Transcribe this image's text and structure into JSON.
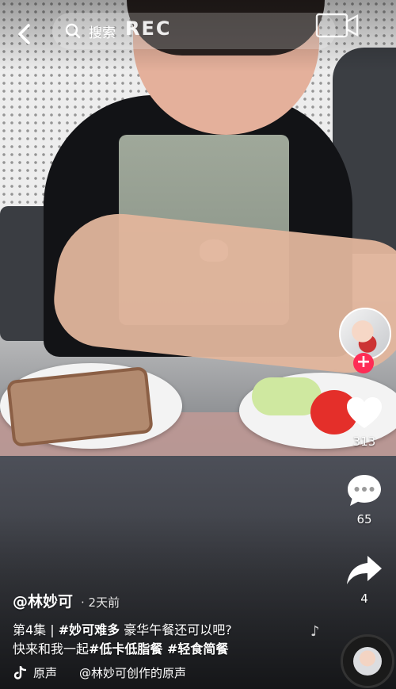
{
  "search": {
    "text": "搜索"
  },
  "overlay_text": "REC",
  "actions": {
    "like_count": "313",
    "comment_count": "65",
    "share_count": "4"
  },
  "caption": {
    "author": "@林妙可",
    "time": "· 2天前",
    "line1_prefix": "第4集 | ",
    "line1_tag": "#妙可难多",
    "line1_rest": " 豪华午餐还可以吧?",
    "line2_prefix": "快来和我一起",
    "line2_tag1": "#低卡低脂餐",
    "line2_tag2": " #轻食简餐"
  },
  "music": {
    "label": "原声",
    "credit": "@林妙可创作的原声"
  },
  "colors": {
    "follow_badge": "#fe2c55"
  }
}
